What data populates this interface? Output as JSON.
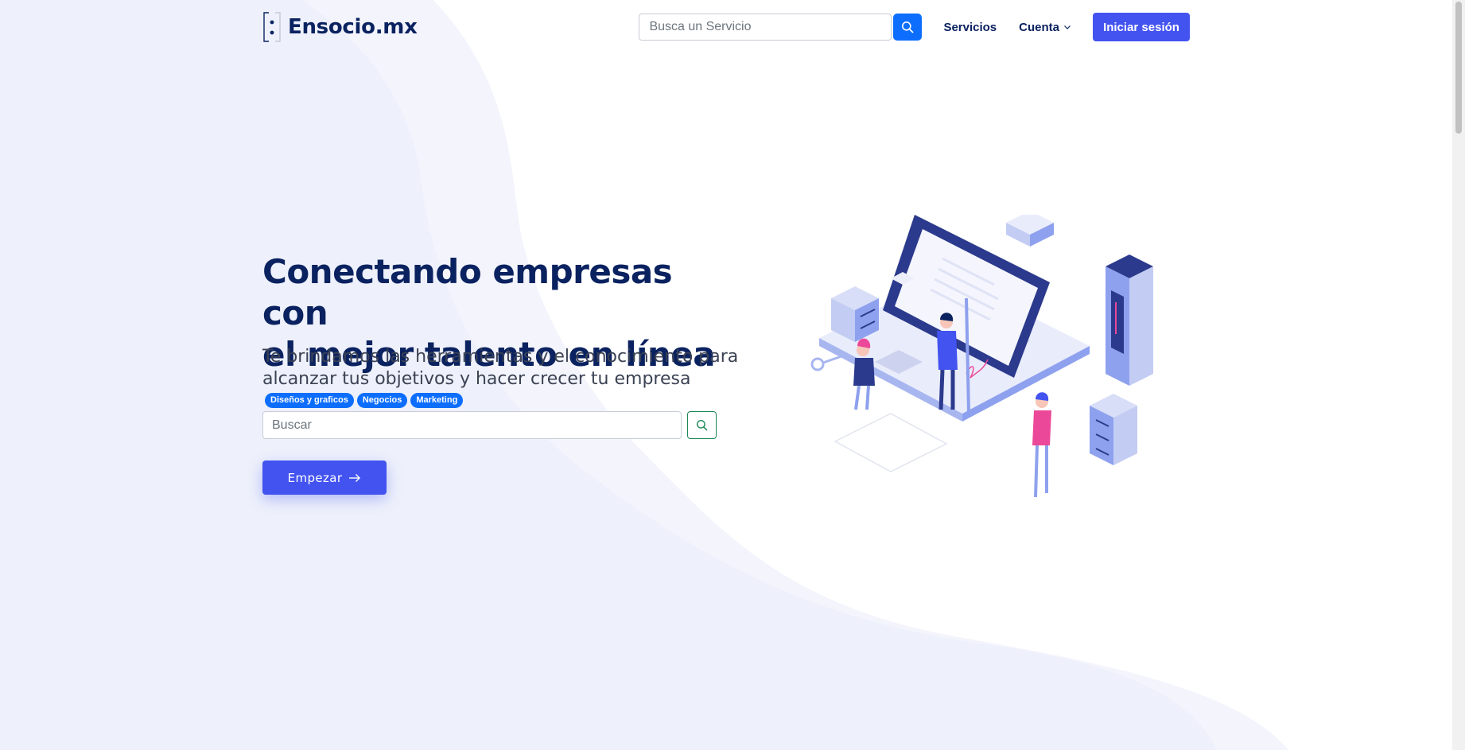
{
  "header": {
    "brand": "Ensocio.mx",
    "search_placeholder": "Busca un Servicio",
    "nav": {
      "servicios": "Servicios",
      "cuenta": "Cuenta"
    },
    "login_label": "Iniciar sesión"
  },
  "hero": {
    "title_line1": "Conectando empresas con",
    "title_line2": "el mejor talento en línea",
    "subtitle_line1": "Te brindamos las herramientas y el conocimiento para",
    "subtitle_line2": "alcanzar tus objetivos y hacer crecer tu empresa",
    "tags": [
      "Diseños y graficos",
      "Negocios",
      "Marketing"
    ],
    "search_placeholder": "Buscar",
    "start_label": "Empezar"
  },
  "colors": {
    "primary": "#4353f0",
    "accent_blue": "#0d6efd",
    "heading": "#0b2260",
    "success_border": "#198754",
    "background_wave": "#f2f4fc"
  },
  "icons": {
    "nav_search": "search-icon",
    "cuenta_caret": "chevron-down-icon",
    "hero_search": "search-icon",
    "start_arrow": "arrow-right-icon"
  }
}
